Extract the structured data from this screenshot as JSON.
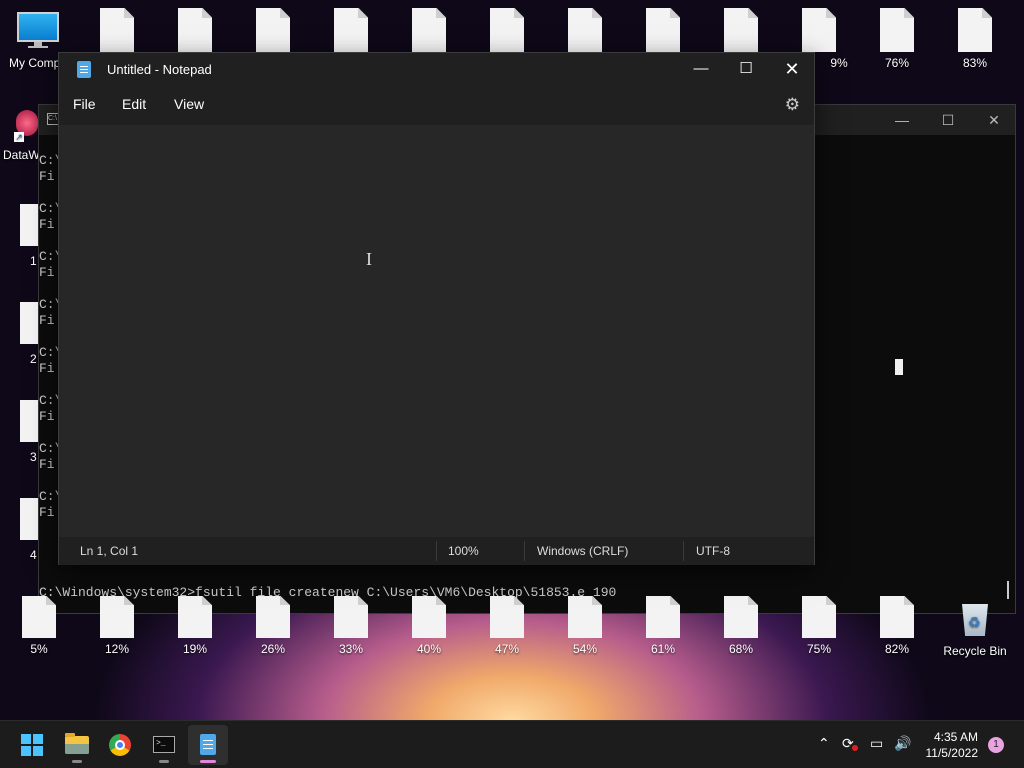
{
  "desktop": {
    "top_icons": [
      {
        "label": "My Compu",
        "kind": "computer"
      },
      {
        "label": "",
        "kind": "doc"
      },
      {
        "label": "",
        "kind": "doc"
      },
      {
        "label": "",
        "kind": "doc"
      },
      {
        "label": "",
        "kind": "doc"
      },
      {
        "label": "",
        "kind": "doc"
      },
      {
        "label": "",
        "kind": "doc"
      },
      {
        "label": "",
        "kind": "doc"
      },
      {
        "label": "",
        "kind": "doc"
      },
      {
        "label": "",
        "kind": "doc"
      },
      {
        "label": "9%",
        "kind": "doc"
      },
      {
        "label": "76%",
        "kind": "doc"
      },
      {
        "label": "83%",
        "kind": "doc"
      }
    ],
    "bottom_icons": [
      {
        "label": "5%"
      },
      {
        "label": "12%"
      },
      {
        "label": "19%"
      },
      {
        "label": "26%"
      },
      {
        "label": "33%"
      },
      {
        "label": "40%"
      },
      {
        "label": "47%"
      },
      {
        "label": "54%"
      },
      {
        "label": "61%"
      },
      {
        "label": "68%"
      },
      {
        "label": "75%"
      },
      {
        "label": "82%"
      },
      {
        "label": "Recycle Bin"
      }
    ],
    "left_icons": [
      {
        "label": "DataW"
      },
      {
        "label": "1"
      },
      {
        "label": "2"
      },
      {
        "label": "3"
      },
      {
        "label": "4"
      }
    ]
  },
  "cmd": {
    "prefix_lines": [
      "C:\\",
      "Fi"
    ],
    "command_line": "C:\\Windows\\system32>fsutil file createnew C:\\Users\\VM6\\Desktop\\51853.e 190"
  },
  "notepad": {
    "title": "Untitled - Notepad",
    "menu": [
      "File",
      "Edit",
      "View"
    ],
    "status": {
      "position": "Ln 1, Col 1",
      "zoom": "100%",
      "line_ending": "Windows (CRLF)",
      "encoding": "UTF-8"
    }
  },
  "taskbar": {
    "time": "4:35 AM",
    "date": "11/5/2022",
    "notification_count": "1"
  }
}
